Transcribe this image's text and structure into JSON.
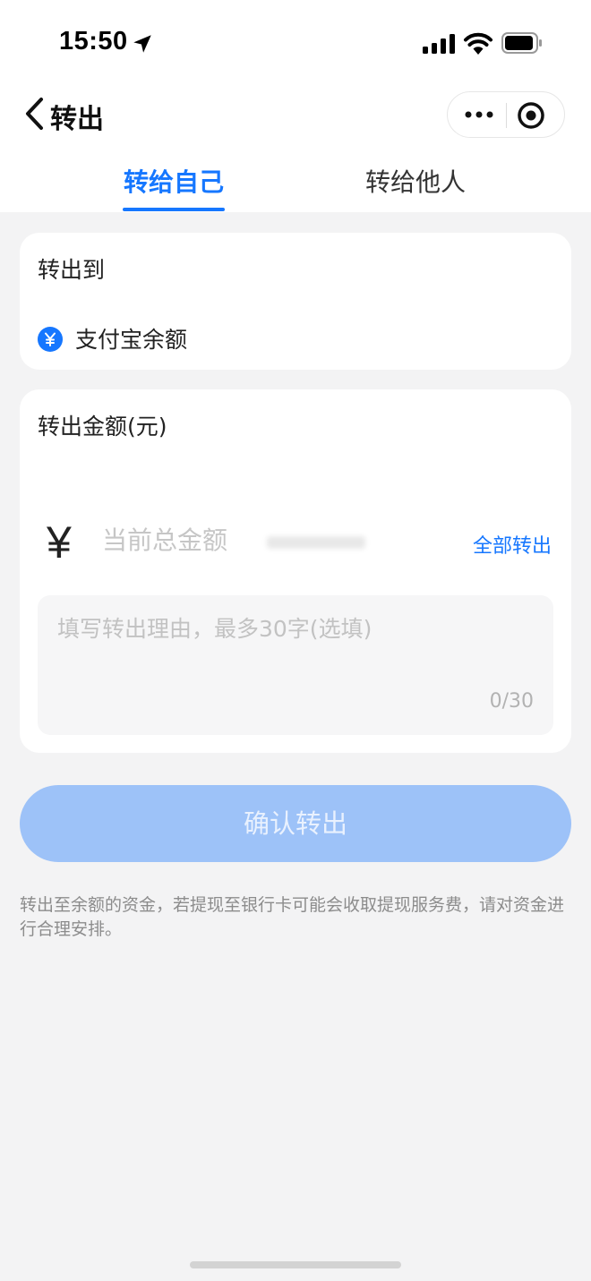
{
  "status_bar": {
    "time": "15:50",
    "icons": [
      "location-arrow-icon",
      "signal-icon",
      "wifi-icon",
      "battery-icon"
    ]
  },
  "nav": {
    "back_icon": "chevron-left-icon",
    "title": "转出",
    "capsule_icons": [
      "more-icon",
      "target-icon"
    ]
  },
  "tabs": [
    {
      "label": "转给自己",
      "active": true
    },
    {
      "label": "转给他人",
      "active": false
    }
  ],
  "destination": {
    "label": "转出到",
    "icon": "yuan-icon",
    "name": "支付宝余额"
  },
  "amount": {
    "label": "转出金额(元)",
    "currency_symbol": "¥",
    "placeholder": "当前总金额",
    "all_out_label": "全部转出"
  },
  "reason": {
    "placeholder": "填写转出理由，最多30字(选填)",
    "count": "0/30"
  },
  "confirm_label": "确认转出",
  "notice": "转出至余额的资金，若提现至银行卡可能会收取提现服务费，请对资金进行合理安排。",
  "colors": {
    "accent": "#1677ff",
    "button_disabled": "#9dc2f8",
    "page_bg": "#f3f3f4"
  }
}
